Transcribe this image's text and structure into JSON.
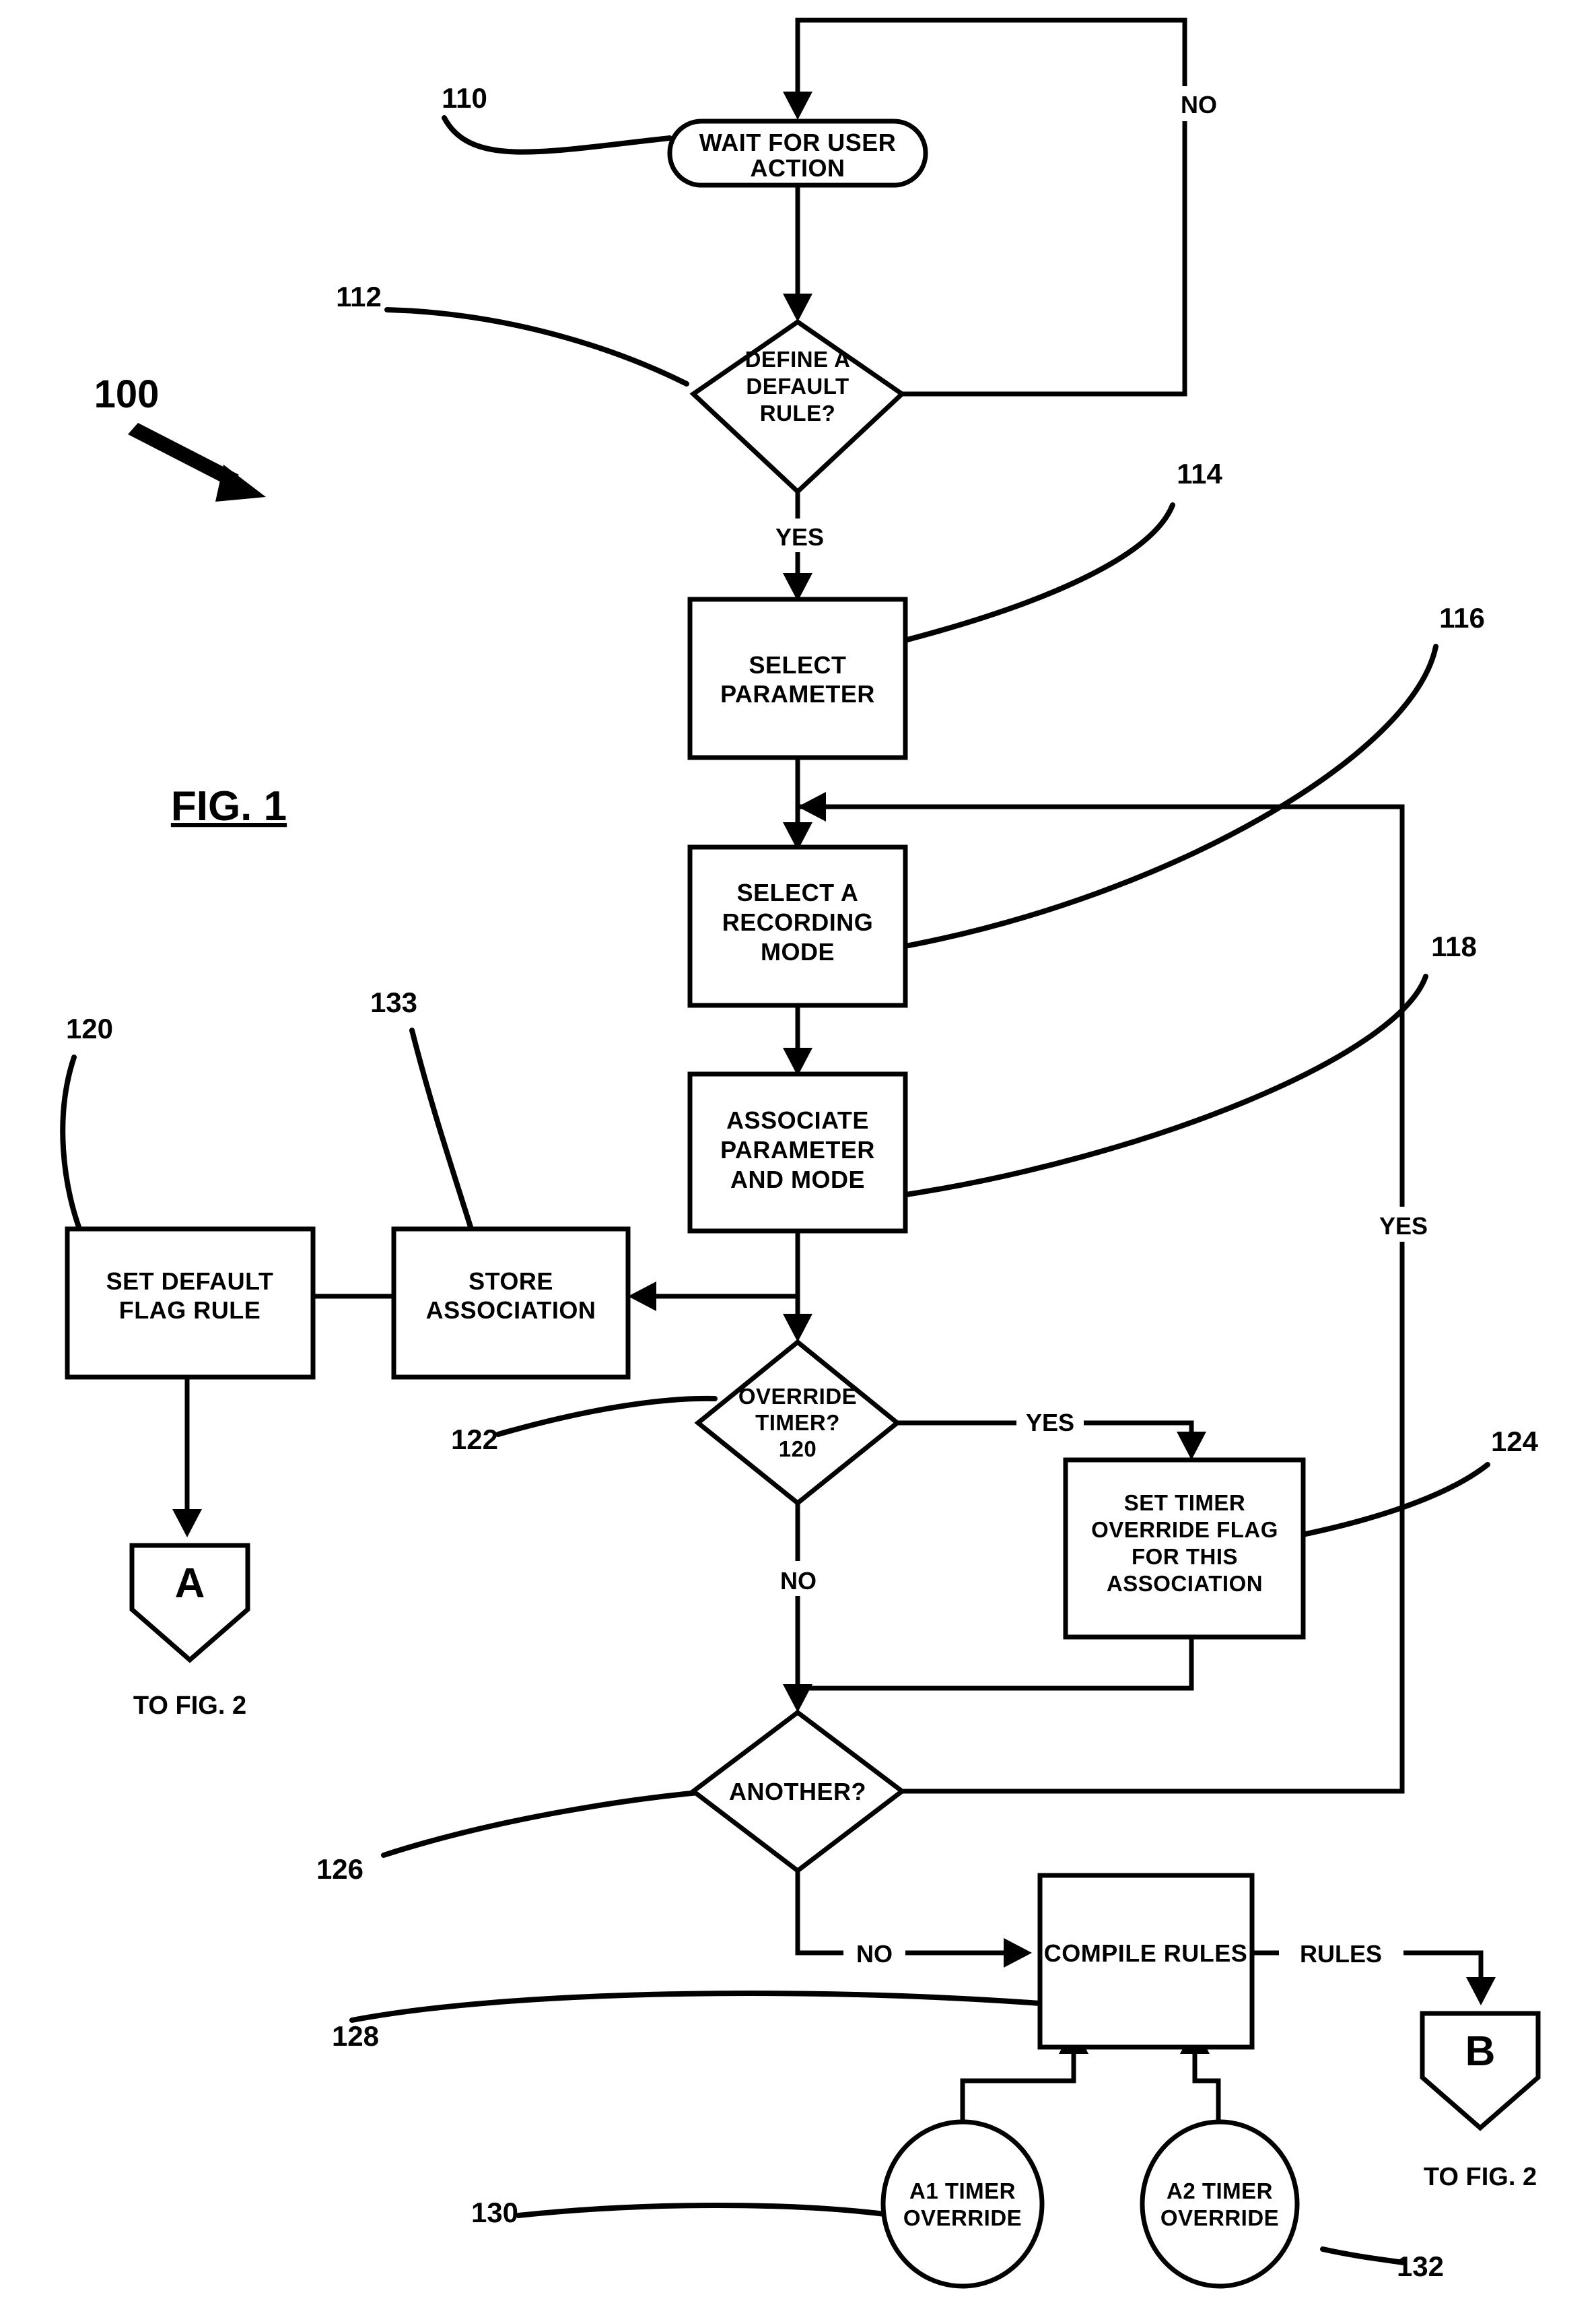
{
  "figure": {
    "label": "FIG. 1",
    "system_ref": "100"
  },
  "nodes": [
    {
      "id": "wait",
      "ref": "110",
      "shape": "rounded",
      "lines": [
        "WAIT FOR USER",
        "ACTION"
      ]
    },
    {
      "id": "define",
      "ref": "112",
      "shape": "diamond",
      "lines": [
        "DEFINE A",
        "DEFAULT",
        "RULE?"
      ]
    },
    {
      "id": "selparam",
      "ref": "114",
      "shape": "rect",
      "lines": [
        "SELECT",
        "PARAMETER"
      ]
    },
    {
      "id": "selmode",
      "ref": "116",
      "shape": "rect",
      "lines": [
        "SELECT A",
        "RECORDING",
        "MODE"
      ]
    },
    {
      "id": "associate",
      "ref": "118",
      "shape": "rect",
      "lines": [
        "ASSOCIATE",
        "PARAMETER",
        "AND MODE"
      ]
    },
    {
      "id": "setflag",
      "ref": "120",
      "shape": "rect",
      "lines": [
        "SET DEFAULT",
        "FLAG RULE"
      ]
    },
    {
      "id": "store",
      "ref": "133",
      "shape": "rect",
      "lines": [
        "STORE",
        "ASSOCIATION"
      ]
    },
    {
      "id": "override",
      "ref": "122",
      "shape": "diamond",
      "lines": [
        "OVERRIDE",
        "TIMER?",
        "120"
      ]
    },
    {
      "id": "settimer",
      "ref": "124",
      "shape": "rect",
      "lines": [
        "SET TIMER",
        "OVERRIDE FLAG",
        "FOR THIS",
        "ASSOCIATION"
      ]
    },
    {
      "id": "another",
      "ref": "126",
      "shape": "diamond",
      "lines": [
        "ANOTHER?"
      ]
    },
    {
      "id": "compile",
      "ref": "128",
      "shape": "rect",
      "lines": [
        "COMPILE RULES"
      ]
    },
    {
      "id": "a1timer",
      "ref": "130",
      "shape": "circle",
      "lines": [
        "A1 TIMER",
        "OVERRIDE"
      ]
    },
    {
      "id": "a2timer",
      "ref": "132",
      "shape": "circle",
      "lines": [
        "A2 TIMER",
        "OVERRIDE"
      ]
    },
    {
      "id": "connA",
      "ref": "",
      "shape": "pentagon",
      "lines": [
        "A"
      ],
      "caption": "TO FIG. 2"
    },
    {
      "id": "connB",
      "ref": "",
      "shape": "pentagon",
      "lines": [
        "B"
      ],
      "caption": "TO FIG. 2"
    }
  ],
  "shapes": {
    "wait": {
      "line1": "WAIT FOR USER",
      "line2": "ACTION"
    },
    "define": {
      "line1": "DEFINE A",
      "line2": "DEFAULT",
      "line3": "RULE?"
    },
    "selparam": {
      "line1": "SELECT",
      "line2": "PARAMETER"
    },
    "selmode": {
      "line1": "SELECT A",
      "line2": "RECORDING",
      "line3": "MODE"
    },
    "associate": {
      "line1": "ASSOCIATE",
      "line2": "PARAMETER",
      "line3": "AND MODE"
    },
    "setflag": {
      "line1": "SET DEFAULT",
      "line2": "FLAG RULE"
    },
    "store": {
      "line1": "STORE",
      "line2": "ASSOCIATION"
    },
    "override": {
      "line1": "OVERRIDE",
      "line2": "TIMER?",
      "line3": "120"
    },
    "settimer": {
      "line1": "SET TIMER",
      "line2": "OVERRIDE FLAG",
      "line3": "FOR THIS",
      "line4": "ASSOCIATION"
    },
    "another": {
      "line1": "ANOTHER?"
    },
    "compile": {
      "line1": "COMPILE RULES"
    },
    "a1timer": {
      "line1": "A1 TIMER",
      "line2": "OVERRIDE"
    },
    "a2timer": {
      "line1": "A2 TIMER",
      "line2": "OVERRIDE"
    },
    "connA": {
      "letter": "A",
      "caption": "TO FIG. 2"
    },
    "connB": {
      "letter": "B",
      "caption": "TO FIG. 2"
    }
  },
  "edge_labels": {
    "define_no": "NO",
    "define_yes": "YES",
    "override_yes": "YES",
    "override_no": "NO",
    "another_yes": "YES",
    "another_no": "NO",
    "compile_out": "RULES"
  },
  "reference_numerals": {
    "wait": "110",
    "define": "112",
    "selparam": "114",
    "selmode": "116",
    "associate": "118",
    "setflag": "120",
    "store": "133",
    "override": "122",
    "settimer": "124",
    "another": "126",
    "compile": "128",
    "a1timer": "130",
    "a2timer": "132",
    "system": "100"
  },
  "colors": {
    "ink": "#000000",
    "paper": "#ffffff"
  }
}
